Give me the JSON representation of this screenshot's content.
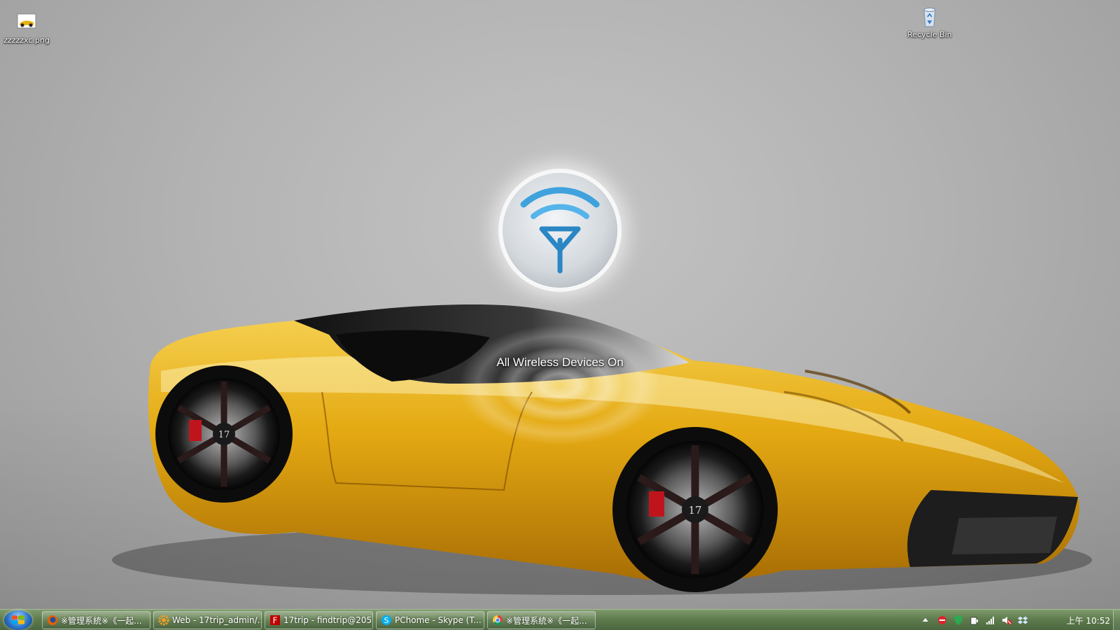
{
  "desktop": {
    "icons": [
      {
        "label": "zzzzzxc.png",
        "icon": "image-file-icon"
      },
      {
        "label": "Recycle Bin",
        "icon": "recycle-bin-icon"
      }
    ],
    "wallpaper": "yellow concept sports car",
    "osd": {
      "text": "All Wireless Devices On",
      "icon": "wireless-antenna-icon"
    }
  },
  "taskbar": {
    "start_icon": "windows-logo-icon",
    "tasks": [
      {
        "label": "※管理系統※《一起...",
        "icon": "firefox-icon"
      },
      {
        "label": "Web - 17trip_admin/...",
        "icon": "gear-icon"
      },
      {
        "label": "17trip - findtrip@205...",
        "icon": "filezilla-icon"
      },
      {
        "label": "PChome - Skype (T...",
        "icon": "skype-icon"
      },
      {
        "label": "※管理系統※《一起...",
        "icon": "chrome-icon"
      }
    ],
    "tray": {
      "icons": [
        "show-hidden-icons-arrow",
        "red-status-icon",
        "green-shield-icon",
        "power-icon",
        "network-signal-icon",
        "volume-muted-icon",
        "dropbox-icon"
      ],
      "clock": "上午 10:52"
    }
  },
  "colors": {
    "taskbar": "#5d7a4c",
    "car": "#e8b016",
    "wireless_arc": "#3fa2dd"
  }
}
